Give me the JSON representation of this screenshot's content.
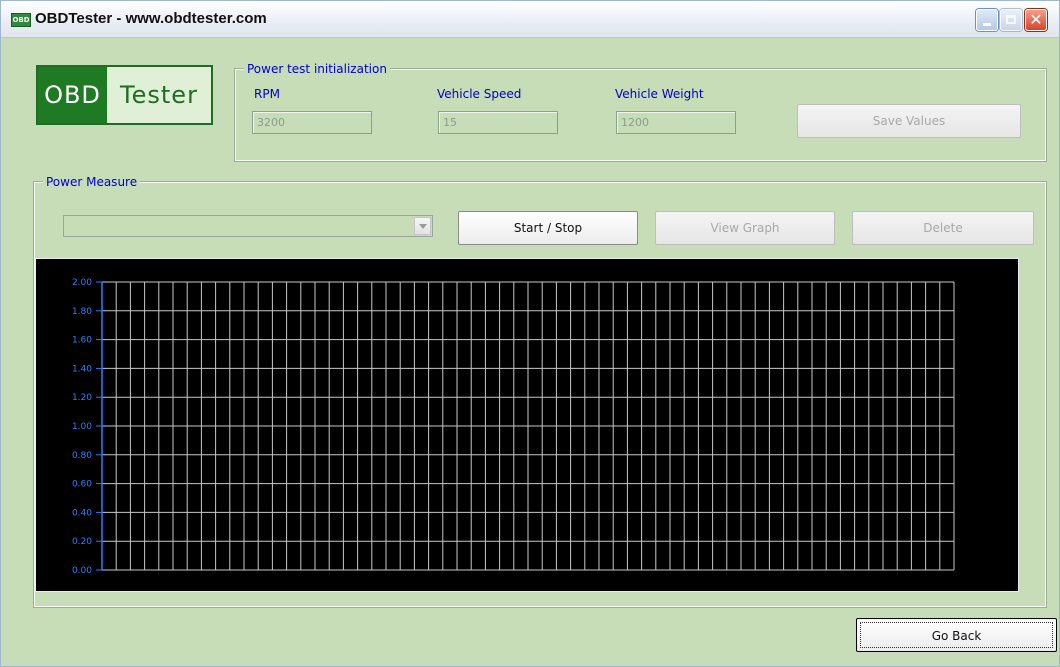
{
  "window": {
    "title": "OBDTester - www.obdtester.com",
    "icon_label": "OBD"
  },
  "logo": {
    "left": "OBD",
    "right": "Tester"
  },
  "power_init": {
    "legend": "Power test initialization",
    "rpm": {
      "label": "RPM",
      "value": "3200"
    },
    "speed": {
      "label": "Vehicle Speed",
      "value": "15"
    },
    "weight": {
      "label": "Vehicle Weight",
      "value": "1200"
    },
    "save_label": "Save Values"
  },
  "power_measure": {
    "legend": "Power Measure",
    "dropdown_value": "",
    "start_stop_label": "Start / Stop",
    "view_graph_label": "View Graph",
    "delete_label": "Delete"
  },
  "go_back_label": "Go Back",
  "chart_data": {
    "type": "line",
    "y_ticks": [
      "0.00",
      "0.20",
      "0.40",
      "0.60",
      "0.80",
      "1.00",
      "1.20",
      "1.40",
      "1.60",
      "1.80",
      "2.00"
    ],
    "ylim": [
      0,
      2
    ],
    "series": [],
    "grid": true,
    "background": "#000000",
    "grid_color": "#c8c8c8",
    "axis_color": "#2a7fff"
  },
  "colors": {
    "background": "#c6ddb8",
    "accent_label": "#0000cc",
    "logo_green": "#1f7a24"
  }
}
